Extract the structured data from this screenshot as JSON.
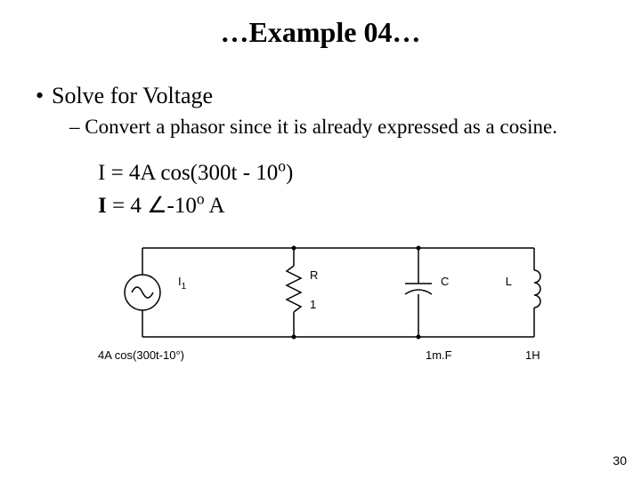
{
  "title": "…Example 04…",
  "bullet1": "Solve for Voltage",
  "bullet2": "Convert a phasor since it is already expressed as a cosine.",
  "eq": {
    "line1_pre": "I = 4A cos(300t - 10",
    "line1_post": ")",
    "line2_pre": "I",
    "line2_mid": "  = 4 ",
    "line2_angle": "∠",
    "line2_post": "-10",
    "line2_unit": " A",
    "sup": "o"
  },
  "circuit": {
    "source_label": "I",
    "source_sub": "1",
    "source_value": "4A cos(300t-10°)",
    "r_label": "R",
    "r_value": "1",
    "c_label": "C",
    "c_value": "1m.F",
    "l_label": "L",
    "l_value": "1H"
  },
  "page_number": "30"
}
